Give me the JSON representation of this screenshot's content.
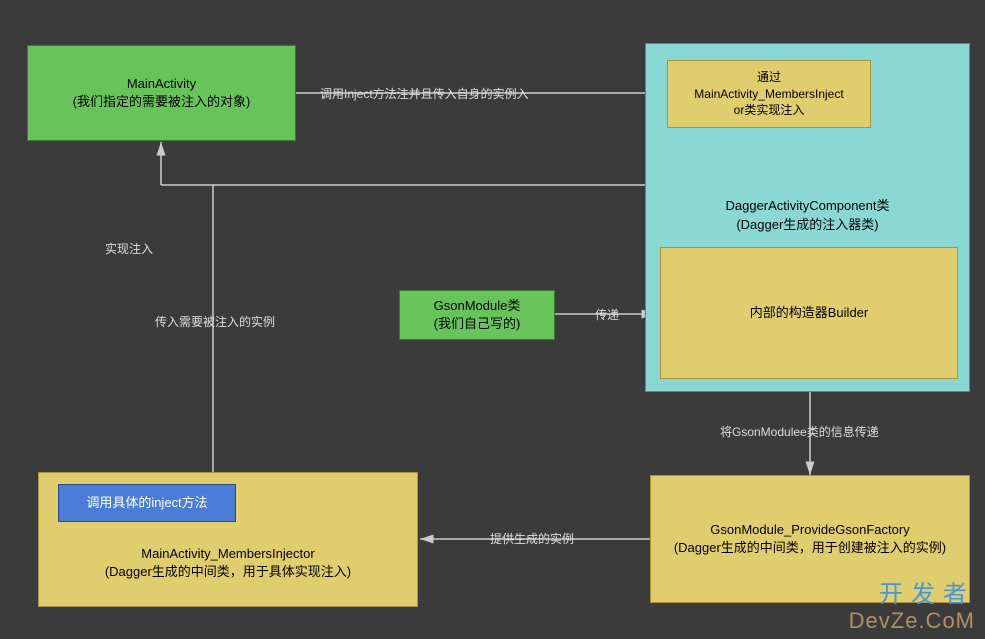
{
  "boxes": {
    "mainActivity": {
      "title": "MainActivity",
      "subtitle": "(我们指定的需要被注入的对象)"
    },
    "daggerComponent": {
      "title": "DaggerActivityComponent类",
      "subtitle": "(Dagger生成的注入器类)"
    },
    "membersInjectorTop": {
      "line1": "通过",
      "line2": "MainActivity_MembersInject",
      "line3": "or类实现注入"
    },
    "builder": {
      "title": "内部的构造器Builder"
    },
    "gsonModule": {
      "title": "GsonModule类",
      "subtitle": "(我们自己写的)"
    },
    "gsonFactory": {
      "title": "GsonModule_ProvideGsonFactory",
      "subtitle": "(Dagger生成的中间类，用于创建被注入的实例)"
    },
    "injectMethod": {
      "title": "调用具体的inject方法"
    },
    "membersInjectorBottom": {
      "title": "MainActivity_MembersInjector",
      "subtitle": "(Dagger生成的中间类，用于具体实现注入)"
    }
  },
  "edges": {
    "e1": "调用Inject方法注并且传入自身的实例入",
    "e2": "传递",
    "e3": "将GsonModulee类的信息传递",
    "e4": "提供生成的实例",
    "e5": "传入需要被注入的实例",
    "e6": "实现注入"
  },
  "watermark": {
    "cn": "开发者",
    "en": "DevZe.CoM"
  }
}
